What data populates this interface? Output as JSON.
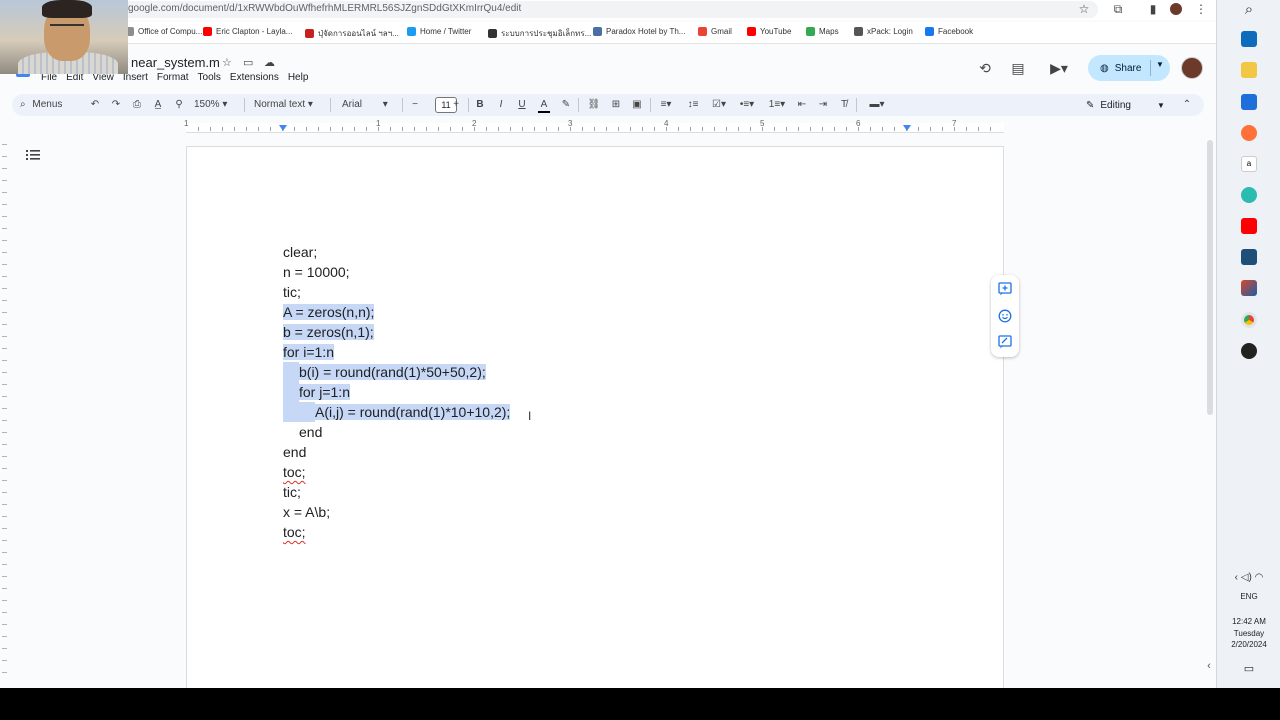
{
  "browser": {
    "url": "google.com/document/d/1xRWWbdOuWfhefrhMLERMRL56SJZgnSDdGtXKmIrrQu4/edit",
    "bookmarks": [
      {
        "label": "Office of Compu...",
        "color": "#8e8e8e"
      },
      {
        "label": "Eric Clapton - Layla...",
        "color": "#ff0000"
      },
      {
        "label": "ปุ่จัดการออนไลน์ ฯลฯ...",
        "color": "#c5221f"
      },
      {
        "label": "Home / Twitter",
        "color": "#1d9bf0"
      },
      {
        "label": "ระบบการประชุมอิเล็กทร...",
        "color": "#333333"
      },
      {
        "label": "Paradox Hotel by Th...",
        "color": "#4a6fa5"
      },
      {
        "label": "Gmail",
        "color": "#ea4335"
      },
      {
        "label": "YouTube",
        "color": "#ff0000"
      },
      {
        "label": "Maps",
        "color": "#34a853"
      },
      {
        "label": "xPack: Login",
        "color": "#555555"
      },
      {
        "label": "Facebook",
        "color": "#1877f2"
      }
    ]
  },
  "doc": {
    "title": "near_system.m",
    "menus": [
      "File",
      "Edit",
      "View",
      "Insert",
      "Format",
      "Tools",
      "Extensions",
      "Help"
    ],
    "share_label": "Share",
    "editing_label": "Editing"
  },
  "toolbar": {
    "search_label": "Menus",
    "zoom": "150%",
    "style": "Normal text",
    "font": "Arial",
    "font_size": "11"
  },
  "ruler": {
    "numbers": [
      "1",
      "1",
      "2",
      "3",
      "4",
      "5",
      "6",
      "7"
    ]
  },
  "code": {
    "lines": [
      {
        "text": "clear;",
        "selected": false,
        "indent": 0
      },
      {
        "text": "n = 10000;",
        "selected": false,
        "indent": 0
      },
      {
        "text": "tic;",
        "selected": false,
        "indent": 0
      },
      {
        "text": "A = zeros(n,n);",
        "selected": true,
        "indent": 0
      },
      {
        "text": "b = zeros(n,1);",
        "selected": true,
        "indent": 0
      },
      {
        "text": "for i=1:n",
        "selected": true,
        "indent": 0
      },
      {
        "text": "b(i) = round(rand(1)*50+50,2);",
        "selected": true,
        "indent": 1
      },
      {
        "text": "for j=1:n",
        "selected": true,
        "indent": 1
      },
      {
        "text": "A(i,j) = round(rand(1)*10+10,2);",
        "selected": true,
        "indent": 2
      },
      {
        "text": "end",
        "selected": false,
        "indent": 1
      },
      {
        "text": "end",
        "selected": false,
        "indent": 0
      },
      {
        "text": "toc;",
        "selected": false,
        "indent": 0,
        "spell": true
      },
      {
        "text": "tic;",
        "selected": false,
        "indent": 0
      },
      {
        "text": "x = A\\b;",
        "selected": false,
        "indent": 0
      },
      {
        "text": "toc;",
        "selected": false,
        "indent": 0,
        "spell": true
      }
    ]
  },
  "system": {
    "language": "ENG",
    "time": "12:42 AM",
    "day": "Tuesday",
    "date": "2/20/2024"
  }
}
